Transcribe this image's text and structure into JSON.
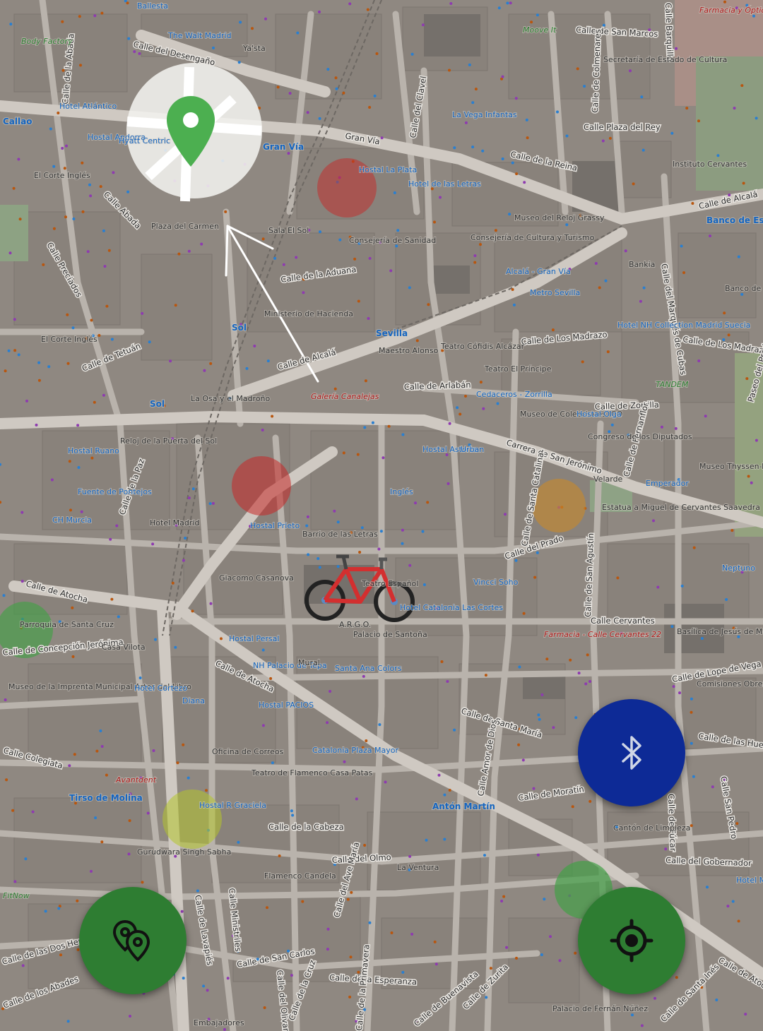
{
  "colors": {
    "map_base": "#8f8881",
    "block": "#8c857e",
    "road": "#bdb7b0",
    "major_road": "#d0cbc5",
    "marker_green": "#4caf50",
    "fab_green": "#2e7d32",
    "fab_bluetooth": "#0d2a96",
    "bike_red": "#d32f2f",
    "blob_red": "#c62828",
    "blob_orange": "#c8892a",
    "blob_green": "#43a047",
    "blob_yellow": "#b5c42c",
    "arrow": "#ffffff"
  },
  "controls": {
    "places_button": {
      "icon": "map-pins-icon"
    },
    "bluetooth_button": {
      "icon": "bluetooth-icon"
    },
    "locate_button": {
      "icon": "crosshair-icon"
    }
  },
  "overlays": {
    "destination_marker": "map-marker-icon",
    "current_position_marker": "bicycle-icon",
    "route_arrow": "arrow-icon"
  },
  "streets": [
    "Calle del Desengaño",
    "Gran Vía",
    "Calle de la Reina",
    "Calle de San Marcos",
    "Calle Plaza del Rey",
    "Calle de Alcalá",
    "Calle de la Aduana",
    "Calle de Alcalá",
    "Calle de Los Madrazo",
    "Calle de Los Madrazo",
    "Calle de Arlabán",
    "Calle de Zorrilla",
    "Carrera de San Jerónimo",
    "Calle del Prado",
    "Calle de Tetuán",
    "Calle de Atocha",
    "Calle de Atocha",
    "Calle Cervantes",
    "Calle de Lope de Vega",
    "Calle de Santa María",
    "Calle de las Huertas",
    "Calle de Moratín",
    "Calle de la Cabeza",
    "Calle del Olmo",
    "Calle de San Carlos",
    "Calle de la Esperanza",
    "Calle Colegiata",
    "Calle de los Abades",
    "Calle del Gobernador",
    "Calle de Lavapiés",
    "Calle Ministriles",
    "Calle del Olivar",
    "Calle del Ave María",
    "Calle Amor de Dios",
    "Calle de Santa Catalina",
    "Calle de San Agustín",
    "Calle de Fernanflor",
    "Calle del Marqués de Cubas",
    "Calle de Fúcar",
    "Calle San Pedro",
    "Calle de Colmenares",
    "Calle Barquillo",
    "Calle del Clavel",
    "Calle de la Abada",
    "Calle Abada",
    "Calle Preciados",
    "Calle de la Paz",
    "Calle de Concepción Jerónima",
    "Calle de las Dos Hermanas",
    "Calle de Buenavista",
    "Calle de Zurita",
    "Calle de Santa Inés",
    "Calle de Atocha",
    "Calle de la Primavera",
    "Paseo del Prado",
    "Calle de la Cruz"
  ],
  "places": [
    "Ballesta",
    "Body Factory",
    "The Walt Madrid",
    "Ya'sta",
    "Hotel Atlántico",
    "Callao",
    "Hostal Andorra",
    "Hyatt Centric",
    "El Corte Inglés",
    "Plaza del Carmen",
    "Gran Vía",
    "Hostal La Plata",
    "Hotel de las Letras",
    "La Vega Infantas",
    "Secretaría de Estado de Cultura",
    "Moove It",
    "Farmacia y Óptica Militar",
    "Instituto Cervantes",
    "Museo del Reloj Grassy",
    "Consejería de Sanidad",
    "Sala El Sol",
    "Consejería de Cultura y Turismo",
    "Banco de España",
    "Alcalá - Gran Vía",
    "Metro Sevilla",
    "Bankia",
    "Banco de España",
    "Ministerio de Hacienda",
    "Sol",
    "Sevilla",
    "Maestro Alonso",
    "Teatro Cófidis Alcázar",
    "Teatro El Príncipe",
    "Hotel NH Collection Madrid Suecia",
    "El Corte Inglés",
    "Galería Canalejas",
    "La Osa y el Madroño",
    "Sol",
    "Cedaceros - Zorrilla",
    "Museo de Colecciones ICO",
    "Hostal Olga",
    "TANDEM",
    "Hostal Ruano",
    "Reloj de la Puerta del Sol",
    "Hostal Astoria",
    "Urban",
    "Congreso de los Diputados",
    "Fuente de Pontejos",
    "Inglés",
    "Hostal Prieto",
    "CH Murcia",
    "Hotel Madrid",
    "Barrio de las Letras",
    "Velarde",
    "Estatua a Miguel de Cervantes Saavedra",
    "Museo Thyssen-Bornemisza",
    "Emperador",
    "Neptuno",
    "Teatro Español",
    "Vincci Soho",
    "Hotel Catalonia Las Cortes",
    "Giacomo Casanova",
    "A.R.G.O.",
    "Palacio de Santoña",
    "Parroquia de Santa Cruz",
    "Casa Vilota",
    "Hostal Persal",
    "Farmacia - Calle Cervantes 22",
    "Basílica de Jesús de Medinaceli",
    "Museo de la Imprenta Municipal Artes del Libro",
    "Hotel Cortezo",
    "NH Palacio de Tepa",
    "Mural",
    "Santa Ana Colors",
    "Diana",
    "Hostal PACIOS",
    "Comisiones Obreras de Madrid",
    "Oficina de Correos",
    "Catalonia Plaza Mayor",
    "Teatro de Flamenco Casa Patas",
    "Avantdent",
    "Tirso de Molina",
    "Antón Martín",
    "Hostal R Graciela",
    "Cantón de Limpieza",
    "Gurudwara Singh Sabha",
    "Flamenco Candela",
    "La Ventura",
    "FitNow",
    "Embajadores",
    "Palacio de Fernán Núñez",
    "Hotel M"
  ]
}
